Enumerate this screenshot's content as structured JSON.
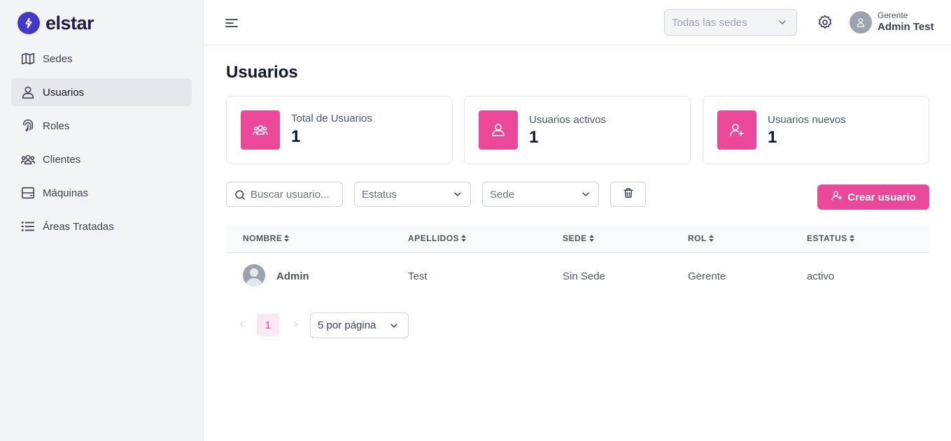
{
  "brand": {
    "name": "elstar"
  },
  "sidebar": {
    "items": [
      {
        "label": "Sedes",
        "icon": "map-icon"
      },
      {
        "label": "Usuarios",
        "icon": "users-icon",
        "active": true
      },
      {
        "label": "Roles",
        "icon": "fingerprint-icon"
      },
      {
        "label": "Clientes",
        "icon": "user-group-icon"
      },
      {
        "label": "Máquinas",
        "icon": "server-icon"
      },
      {
        "label": "Áreas Tratadas",
        "icon": "list-icon"
      }
    ]
  },
  "header": {
    "sede_placeholder": "Todas las sedes",
    "user_role": "Gerente",
    "user_name": "Admin Test"
  },
  "main": {
    "title": "Usuarios",
    "stats": [
      {
        "label": "Total de Usuarios",
        "value": "1",
        "icon": "user-group-icon"
      },
      {
        "label": "Usuarios activos",
        "value": "1",
        "icon": "users-icon"
      },
      {
        "label": "Usuarios nuevos",
        "value": "1",
        "icon": "user-add-icon"
      }
    ],
    "filters": {
      "search_placeholder": "Buscar usuario...",
      "status_placeholder": "Estatus",
      "sede_placeholder": "Sede"
    },
    "create_button": "Crear usuario",
    "table": {
      "headers": [
        "NOMBRE",
        "APELLIDOS",
        "SEDE",
        "ROL",
        "ESTATUS"
      ],
      "rows": [
        {
          "nombre": "Admin",
          "apellidos": "Test",
          "sede": "Sin Sede",
          "rol": "Gerente",
          "estatus": "activo"
        }
      ]
    },
    "pagination": {
      "current_page": "1",
      "per_page": "5 por página"
    }
  },
  "colors": {
    "accent": "#ec4899",
    "brand": "#4338ca"
  }
}
